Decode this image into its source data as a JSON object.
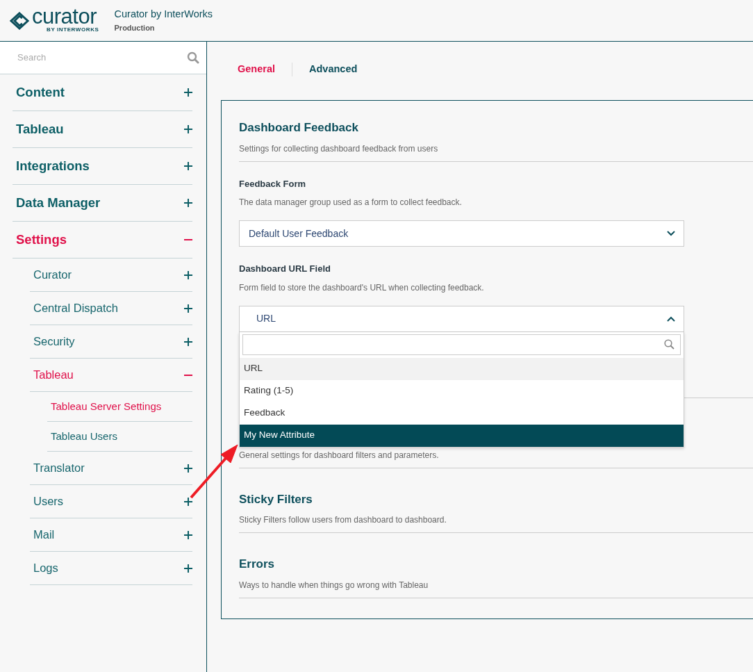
{
  "header": {
    "logo": {
      "wordmark": "curator",
      "tagline": "BY INTERWORKS"
    },
    "app_title": "Curator by InterWorks",
    "environment": "Production"
  },
  "sidebar": {
    "search": {
      "placeholder": "Search"
    },
    "items": [
      {
        "label": "Content",
        "expanded": false,
        "selected": false
      },
      {
        "label": "Tableau",
        "expanded": false,
        "selected": false
      },
      {
        "label": "Integrations",
        "expanded": false,
        "selected": false
      },
      {
        "label": "Data Manager",
        "expanded": false,
        "selected": false
      },
      {
        "label": "Settings",
        "expanded": true,
        "selected": true,
        "children": [
          {
            "label": "Curator",
            "expanded": false,
            "selected": false
          },
          {
            "label": "Central Dispatch",
            "expanded": false,
            "selected": false
          },
          {
            "label": "Security",
            "expanded": false,
            "selected": false
          },
          {
            "label": "Tableau",
            "expanded": true,
            "selected": true,
            "children": [
              {
                "label": "Tableau Server Settings",
                "selected": true
              },
              {
                "label": "Tableau Users",
                "selected": false
              }
            ]
          },
          {
            "label": "Translator",
            "expanded": false,
            "selected": false
          },
          {
            "label": "Users",
            "expanded": false,
            "selected": false
          },
          {
            "label": "Mail",
            "expanded": false,
            "selected": false
          },
          {
            "label": "Logs",
            "expanded": false,
            "selected": false
          }
        ]
      }
    ]
  },
  "tabs": [
    {
      "label": "General",
      "selected": true
    },
    {
      "label": "Advanced",
      "selected": false
    }
  ],
  "sections": [
    {
      "title": "Dashboard Feedback",
      "description": "Settings for collecting dashboard feedback from users",
      "fields": [
        {
          "label": "Feedback Form",
          "help": "The data manager group used as a form to collect feedback.",
          "value": "Default User Feedback",
          "expanded": false
        },
        {
          "label": "Dashboard URL Field",
          "help": "Form field to store the dashboard's URL when collecting feedback.",
          "value": "URL",
          "expanded": true,
          "options": [
            {
              "label": "URL",
              "selected": true,
              "highlighted": false
            },
            {
              "label": "Rating (1-5)",
              "selected": false,
              "highlighted": false
            },
            {
              "label": "Feedback",
              "selected": false,
              "highlighted": false
            },
            {
              "label": "My New Attribute",
              "selected": false,
              "highlighted": true
            }
          ]
        }
      ]
    },
    {
      "description": "General settings for dashboard filters and parameters."
    },
    {
      "title": "Sticky Filters",
      "description": "Sticky Filters follow users from dashboard to dashboard."
    },
    {
      "title": "Errors",
      "description": "Ways to handle when things go wrong with Tableau"
    }
  ]
}
